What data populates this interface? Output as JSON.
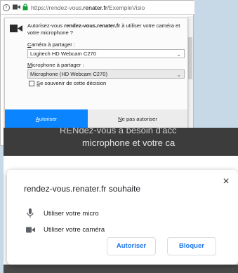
{
  "firefox": {
    "url_prefix": "https://rendez-vous.",
    "url_host": "renater.fr",
    "url_path": "/ExempleVisio",
    "prompt_before": "Autorisez-vous ",
    "prompt_host": "rendez-vous.renater.fr",
    "prompt_after": " à utiliser votre caméra et votre microphone ?",
    "camera_label_first": "C",
    "camera_label_rest": "améra à partager :",
    "camera_value": "Logitech HD Webcam C270",
    "mic_label_first": "M",
    "mic_label_rest": "icrophone à partager :",
    "mic_value": "Microphone (HD Webcam C270)",
    "remember_first": "S",
    "remember_rest": "e souvenir de cette décision",
    "allow_first": "A",
    "allow_rest": "utoriser",
    "deny_first": "N",
    "deny_rest": "e pas autoriser",
    "accent": "#0a84ff"
  },
  "page": {
    "line1": "RENdez-vous a besoin d'acc",
    "line2": "microphone et votre ca"
  },
  "chrome": {
    "title": "rendez-vous.renater.fr souhaite",
    "perm_mic": "Utiliser votre micro",
    "perm_cam": "Utiliser votre caméra",
    "allow": "Autoriser",
    "block": "Bloquer",
    "close_glyph": "×",
    "accent": "#1a73e8"
  },
  "icons": {
    "urlbar": [
      "info-icon",
      "camera-icon",
      "lock-icon"
    ],
    "doorhanger": "camera-icon",
    "chrome_perms": [
      "microphone-icon",
      "camera-icon"
    ]
  }
}
